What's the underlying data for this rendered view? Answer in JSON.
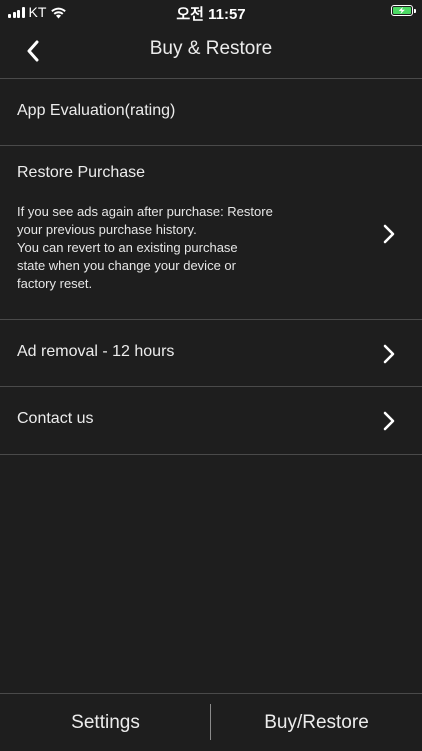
{
  "status_bar": {
    "carrier": "KT",
    "time": "오전 11:57",
    "battery_color": "#4cd964"
  },
  "nav": {
    "back_icon": "chevron-left-icon",
    "title": "Buy & Restore"
  },
  "menu": {
    "items": [
      {
        "label": "App Evaluation(rating)",
        "has_chevron": false
      },
      {
        "label": "Restore Purchase",
        "description_lines": [
          "If you see ads again after purchase: Restore",
          "your previous purchase history.",
          "You can revert to an existing purchase",
          "state when you change your device or",
          "factory reset."
        ],
        "has_chevron": true
      },
      {
        "label": "Ad removal - 12 hours",
        "has_chevron": true
      },
      {
        "label": "Contact us",
        "has_chevron": true
      }
    ]
  },
  "tabs": [
    {
      "label": "Settings"
    },
    {
      "label": "Buy/Restore"
    }
  ],
  "colors": {
    "background": "#1e1e1e",
    "divider": "#4a4a4a",
    "text": "#ececec"
  }
}
